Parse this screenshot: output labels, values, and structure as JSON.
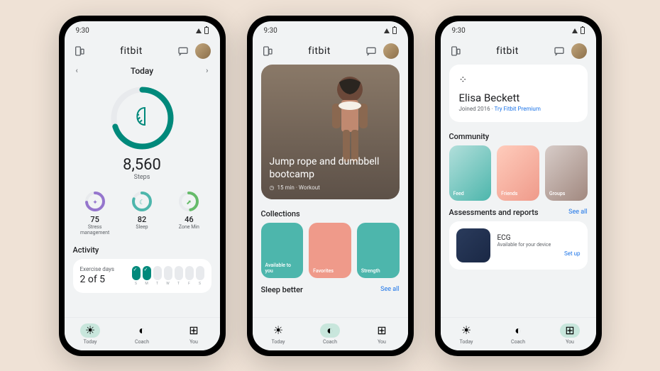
{
  "status_time": "9:30",
  "app_name": "fitbit",
  "screen1": {
    "date": "Today",
    "steps_value": "8,560",
    "steps_label": "Steps",
    "minis": [
      {
        "value": "75",
        "label": "Stress\nmanagement",
        "color": "#9575cd"
      },
      {
        "value": "82",
        "label": "Sleep",
        "color": "#4db6ac"
      },
      {
        "value": "46",
        "label": "Zone Min",
        "color": "#66bb6a"
      }
    ],
    "activity_label": "Activity",
    "exercise_label": "Exercise days",
    "exercise_progress": "2 of 5"
  },
  "screen2": {
    "hero_title": "Jump rope and dumbbell bootcamp",
    "hero_meta": "15 min · Workout",
    "collections_label": "Collections",
    "collections": [
      {
        "label": "Available to you"
      },
      {
        "label": "Favorites"
      },
      {
        "label": "Strength"
      }
    ],
    "sleep_label": "Sleep better",
    "see_all": "See all"
  },
  "screen3": {
    "profile_name": "Elisa Beckett",
    "profile_sub": "Joined 2016 · ",
    "profile_link": "Try Fitbit Premium",
    "community_label": "Community",
    "community": [
      {
        "label": "Feed"
      },
      {
        "label": "Friends"
      },
      {
        "label": "Groups"
      }
    ],
    "assessments_label": "Assessments and reports",
    "see_all": "See all",
    "ecg_title": "ECG",
    "ecg_sub": "Available for your device",
    "setup": "Set up"
  },
  "nav": {
    "today": "Today",
    "coach": "Coach",
    "you": "You"
  }
}
